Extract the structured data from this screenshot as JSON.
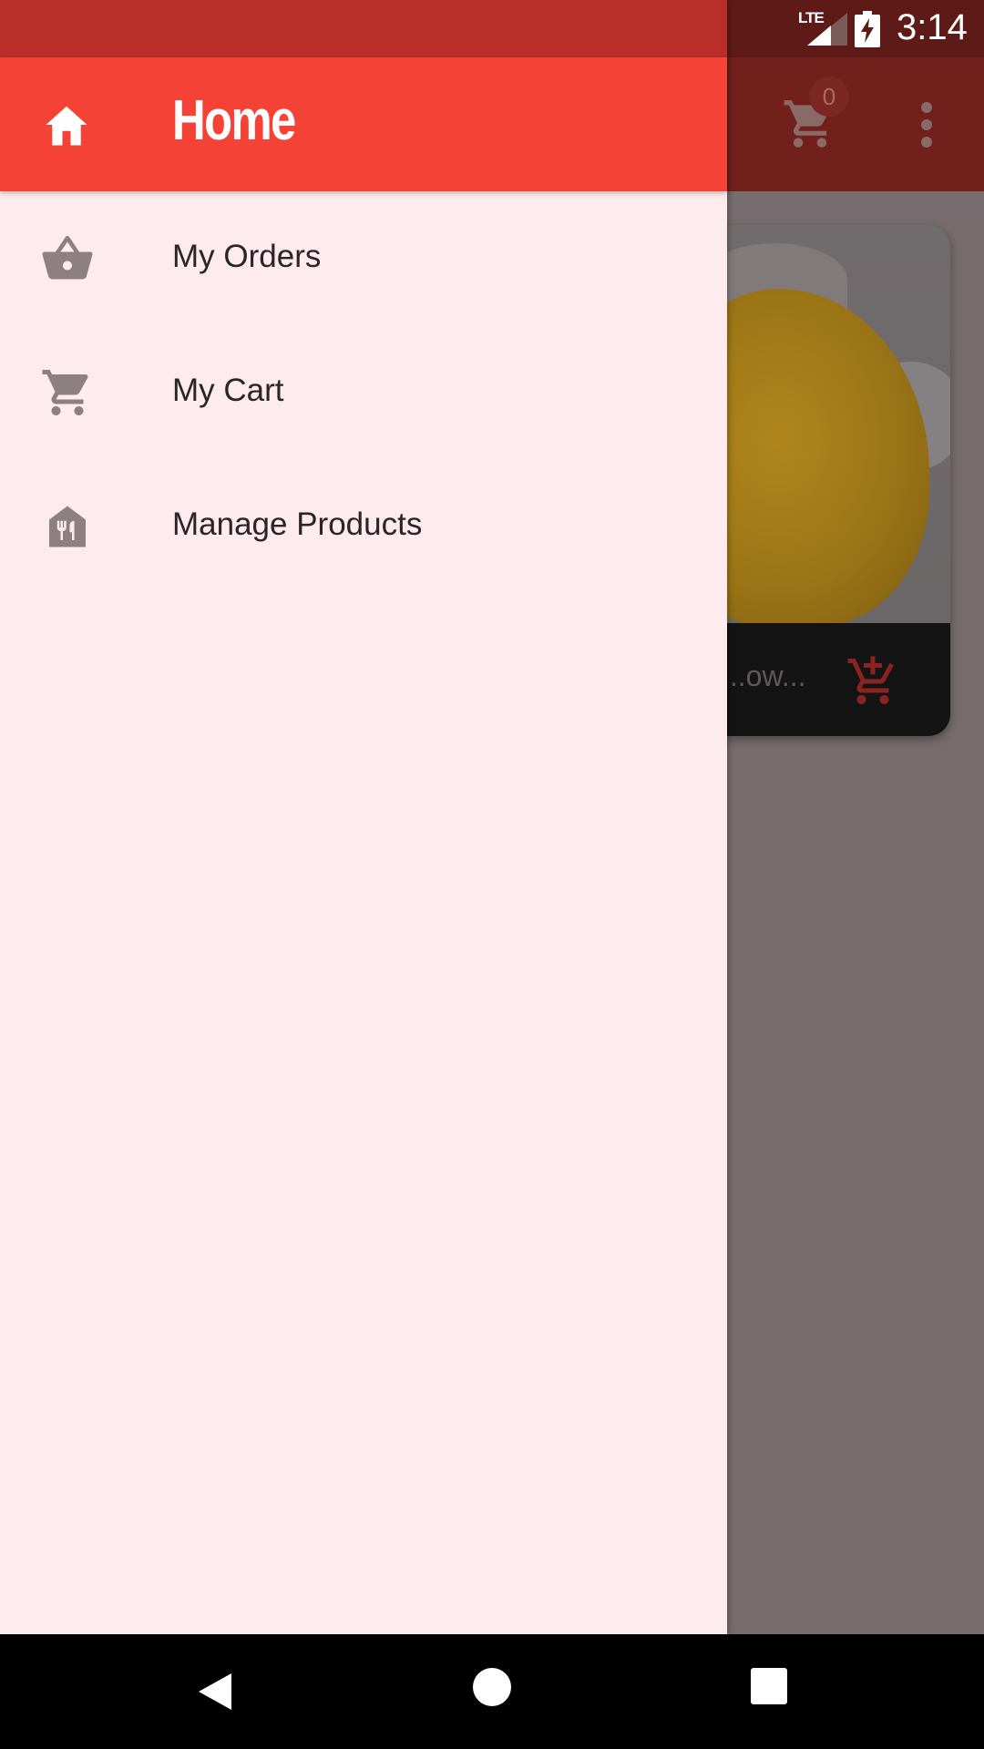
{
  "status_bar": {
    "network": "LTE",
    "time": "3:14"
  },
  "app_bar": {
    "cart_count": "0",
    "icons": [
      "shopping-cart-icon",
      "more-vert-icon"
    ]
  },
  "product": {
    "name": "...ow...",
    "add_to_cart_icon": "add-shopping-cart-icon"
  },
  "drawer": {
    "header": {
      "title": "Home",
      "icon": "home-icon"
    },
    "items": [
      {
        "label": "My Orders",
        "icon": "shopping-basket-icon"
      },
      {
        "label": "My Cart",
        "icon": "shopping-cart-icon"
      },
      {
        "label": "Manage Products",
        "icon": "store-icon"
      }
    ]
  },
  "colors": {
    "primary": "#f44336",
    "status_bar": "#b92e28",
    "drawer_background": "#feebed",
    "scrim": "#776c6e"
  },
  "navigation_bar": {
    "buttons": [
      "back-icon",
      "home-circle-icon",
      "recents-icon"
    ]
  }
}
